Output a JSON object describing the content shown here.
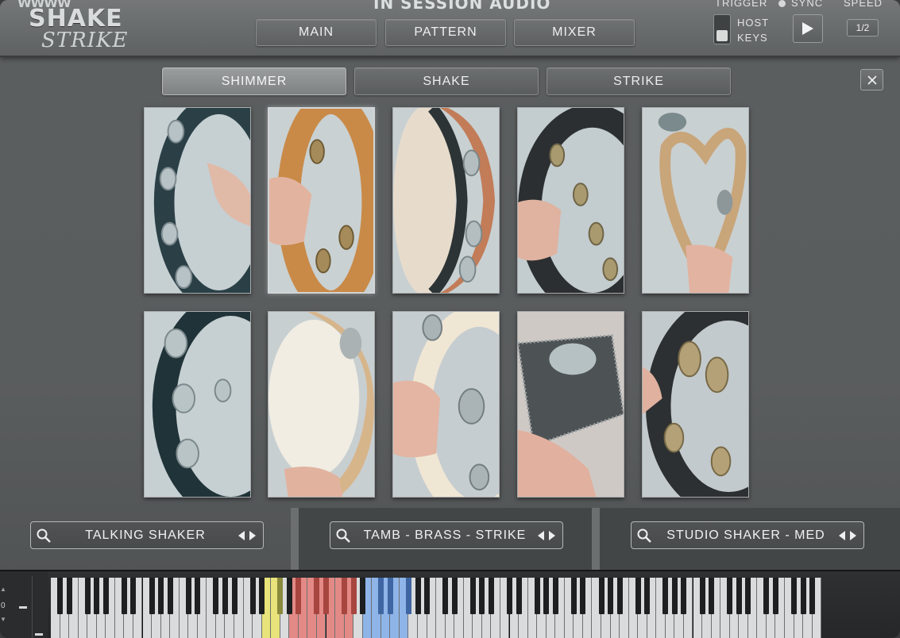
{
  "header": {
    "logo_top": "WWWW",
    "logo_shake": "SHAKE",
    "logo_strike": "STRIKE",
    "brand": "IN SESSION AUDIO",
    "nav": [
      {
        "label": "MAIN"
      },
      {
        "label": "PATTERN"
      },
      {
        "label": "MIXER"
      }
    ],
    "trigger_label": "TRIGGER",
    "sync_label": "SYNC",
    "speed_label": "SPEED",
    "host_keys_label": "HOST KEYS",
    "speed_value": "1/2"
  },
  "categories": [
    {
      "label": "SHIMMER",
      "active": true
    },
    {
      "label": "SHAKE",
      "active": false
    },
    {
      "label": "STRIKE",
      "active": false
    }
  ],
  "instruments": [
    {
      "name": "tambourine-black-headless",
      "selected": false
    },
    {
      "name": "tambourine-wood-natural",
      "selected": true
    },
    {
      "name": "tambourine-headed-side",
      "selected": false
    },
    {
      "name": "tambourine-black-jingles",
      "selected": false
    },
    {
      "name": "rattle-wicker-heart",
      "selected": false
    },
    {
      "name": "tambourine-black-ring",
      "selected": false
    },
    {
      "name": "tambourine-headed-wood",
      "selected": false
    },
    {
      "name": "tambourine-white-brass",
      "selected": false
    },
    {
      "name": "jingle-stick-hammered",
      "selected": false
    },
    {
      "name": "tambourine-dark-brass",
      "selected": false
    }
  ],
  "slots": [
    {
      "label": "TALKING SHAKER"
    },
    {
      "label": "TAMB - BRASS - STRIKE"
    },
    {
      "label": "STUDIO SHAKER - MED"
    }
  ],
  "keyboard": {
    "octave": "0",
    "highlight_colors": {
      "yellow": "#e8e37a",
      "red": "#e38a86",
      "blue": "#8fb4e8"
    }
  },
  "colors": {
    "panel": "#5b5e5f",
    "accent_light": "#d9dbdc"
  }
}
